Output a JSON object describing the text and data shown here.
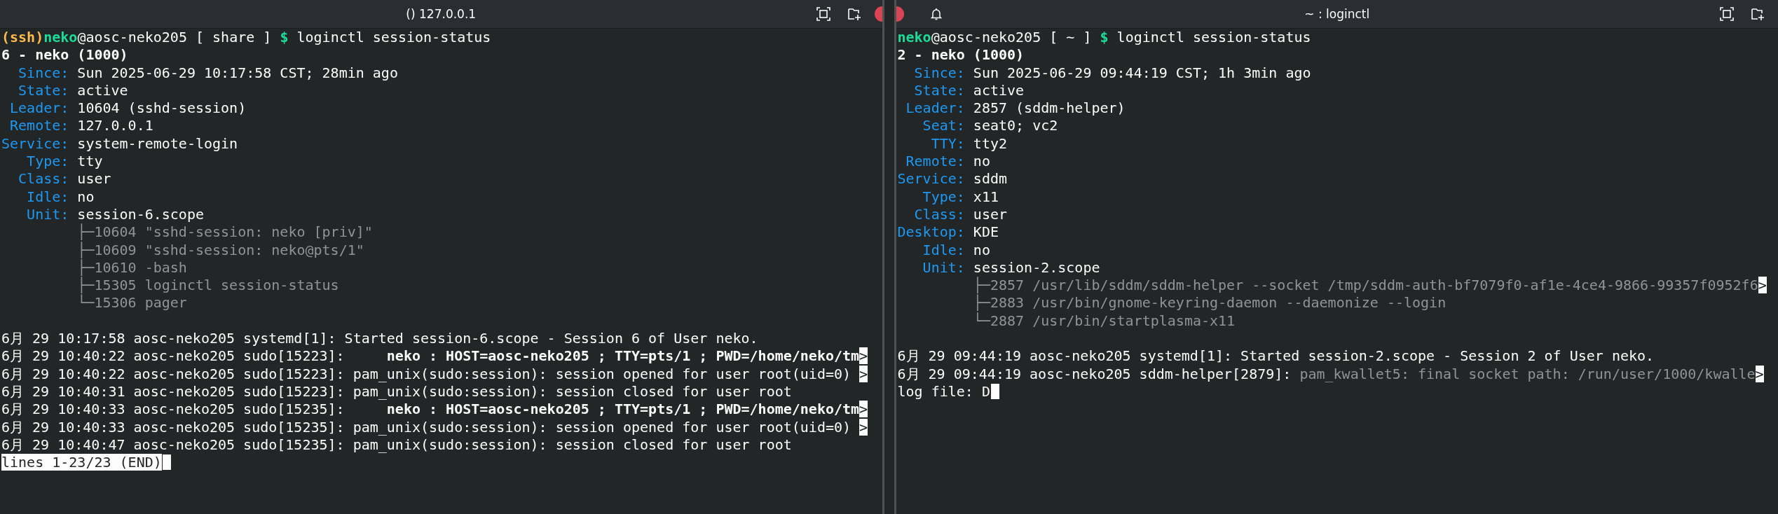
{
  "panes": [
    {
      "title": "() 127.0.0.1",
      "bell": false,
      "lines": [
        {
          "kind": "prompt",
          "ssh": "(ssh)",
          "user": "neko",
          "host": "@aosc-neko205 [ share ] ",
          "symbol": "$",
          "command": " loginctl session-status"
        },
        {
          "kind": "heading",
          "text": "6 - neko (1000)"
        },
        {
          "kind": "field",
          "label": "Since:",
          "value": "Sun 2025-06-29 10:17:58 CST; 28min ago"
        },
        {
          "kind": "field",
          "label": "State:",
          "value": "active"
        },
        {
          "kind": "field",
          "label": "Leader:",
          "value": "10604 (sshd-session)"
        },
        {
          "kind": "field",
          "label": "Remote:",
          "value": "127.0.0.1"
        },
        {
          "kind": "field",
          "label": "Service:",
          "value": "system-remote-login"
        },
        {
          "kind": "field",
          "label": "Type:",
          "value": "tty"
        },
        {
          "kind": "field",
          "label": "Class:",
          "value": "user"
        },
        {
          "kind": "field",
          "label": "Idle:",
          "value": "no"
        },
        {
          "kind": "field",
          "label": "Unit:",
          "value": "session-6.scope"
        },
        {
          "kind": "tree",
          "text": "├─10604 \"sshd-session: neko [priv]\""
        },
        {
          "kind": "tree",
          "text": "├─10609 \"sshd-session: neko@pts/1\""
        },
        {
          "kind": "tree",
          "text": "├─10610 -bash"
        },
        {
          "kind": "tree",
          "text": "├─15305 loginctl session-status"
        },
        {
          "kind": "tree",
          "text": "└─15306 pager"
        },
        {
          "kind": "blank"
        },
        {
          "kind": "log",
          "text": "6月 29 10:17:58 aosc-neko205 systemd[1]: Started session-6.scope - Session 6 of User neko."
        },
        {
          "kind": "log",
          "text": "6月 29 10:40:22 aosc-neko205 sudo[15223]:     **neko : HOST=aosc-neko205 ; TTY=pts/1 ; PWD=/home/neko/tm**",
          "marker": ">"
        },
        {
          "kind": "log",
          "text": "6月 29 10:40:22 aosc-neko205 sudo[15223]: pam_unix(sudo:session): session opened for user root(uid=0) ",
          "marker": ">"
        },
        {
          "kind": "log",
          "text": "6月 29 10:40:31 aosc-neko205 sudo[15223]: pam_unix(sudo:session): session closed for user root"
        },
        {
          "kind": "log",
          "text": "6月 29 10:40:33 aosc-neko205 sudo[15235]:     **neko : HOST=aosc-neko205 ; TTY=pts/1 ; PWD=/home/neko/tm**",
          "marker": ">"
        },
        {
          "kind": "log",
          "text": "6月 29 10:40:33 aosc-neko205 sudo[15235]: pam_unix(sudo:session): session opened for user root(uid=0) ",
          "marker": ">"
        },
        {
          "kind": "log",
          "text": "6月 29 10:40:47 aosc-neko205 sudo[15235]: pam_unix(sudo:session): session closed for user root"
        },
        {
          "kind": "status",
          "text": "lines 1-23/23 (END)",
          "cursor": true
        }
      ]
    },
    {
      "title": "~ : loginctl",
      "bell": true,
      "lines": [
        {
          "kind": "prompt",
          "user": "neko",
          "host": "@aosc-neko205 [ ~ ] ",
          "symbol": "$",
          "command": " loginctl session-status"
        },
        {
          "kind": "heading",
          "text": "2 - neko (1000)"
        },
        {
          "kind": "field",
          "label": "Since:",
          "value": "Sun 2025-06-29 09:44:19 CST; 1h 3min ago"
        },
        {
          "kind": "field",
          "label": "State:",
          "value": "active"
        },
        {
          "kind": "field",
          "label": "Leader:",
          "value": "2857 (sddm-helper)"
        },
        {
          "kind": "field",
          "label": "Seat:",
          "value": "seat0; vc2"
        },
        {
          "kind": "field",
          "label": "TTY:",
          "value": "tty2"
        },
        {
          "kind": "field",
          "label": "Remote:",
          "value": "no"
        },
        {
          "kind": "field",
          "label": "Service:",
          "value": "sddm"
        },
        {
          "kind": "field",
          "label": "Type:",
          "value": "x11"
        },
        {
          "kind": "field",
          "label": "Class:",
          "value": "user"
        },
        {
          "kind": "field",
          "label": "Desktop:",
          "value": "KDE"
        },
        {
          "kind": "field",
          "label": "Idle:",
          "value": "no"
        },
        {
          "kind": "field",
          "label": "Unit:",
          "value": "session-2.scope"
        },
        {
          "kind": "tree",
          "text": "├─2857 /usr/lib/sddm/sddm-helper --socket /tmp/sddm-auth-bf7079f0-af1e-4ce4-9866-99357f0952f6",
          "marker": ">"
        },
        {
          "kind": "tree",
          "text": "├─2883 /usr/bin/gnome-keyring-daemon --daemonize --login"
        },
        {
          "kind": "tree",
          "text": "└─2887 /usr/bin/startplasma-x11"
        },
        {
          "kind": "blank"
        },
        {
          "kind": "log",
          "text": "6月 29 09:44:19 aosc-neko205 systemd[1]: Started session-2.scope - Session 2 of User neko."
        },
        {
          "kind": "log",
          "text": "6月 29 09:44:19 aosc-neko205 sddm-helper[2879]: ",
          "dim": "pam_kwallet5: final socket path: /run/user/1000/kwalle",
          "marker": ">"
        },
        {
          "kind": "plain",
          "text": "log file: D",
          "cursor": true
        }
      ]
    }
  ]
}
